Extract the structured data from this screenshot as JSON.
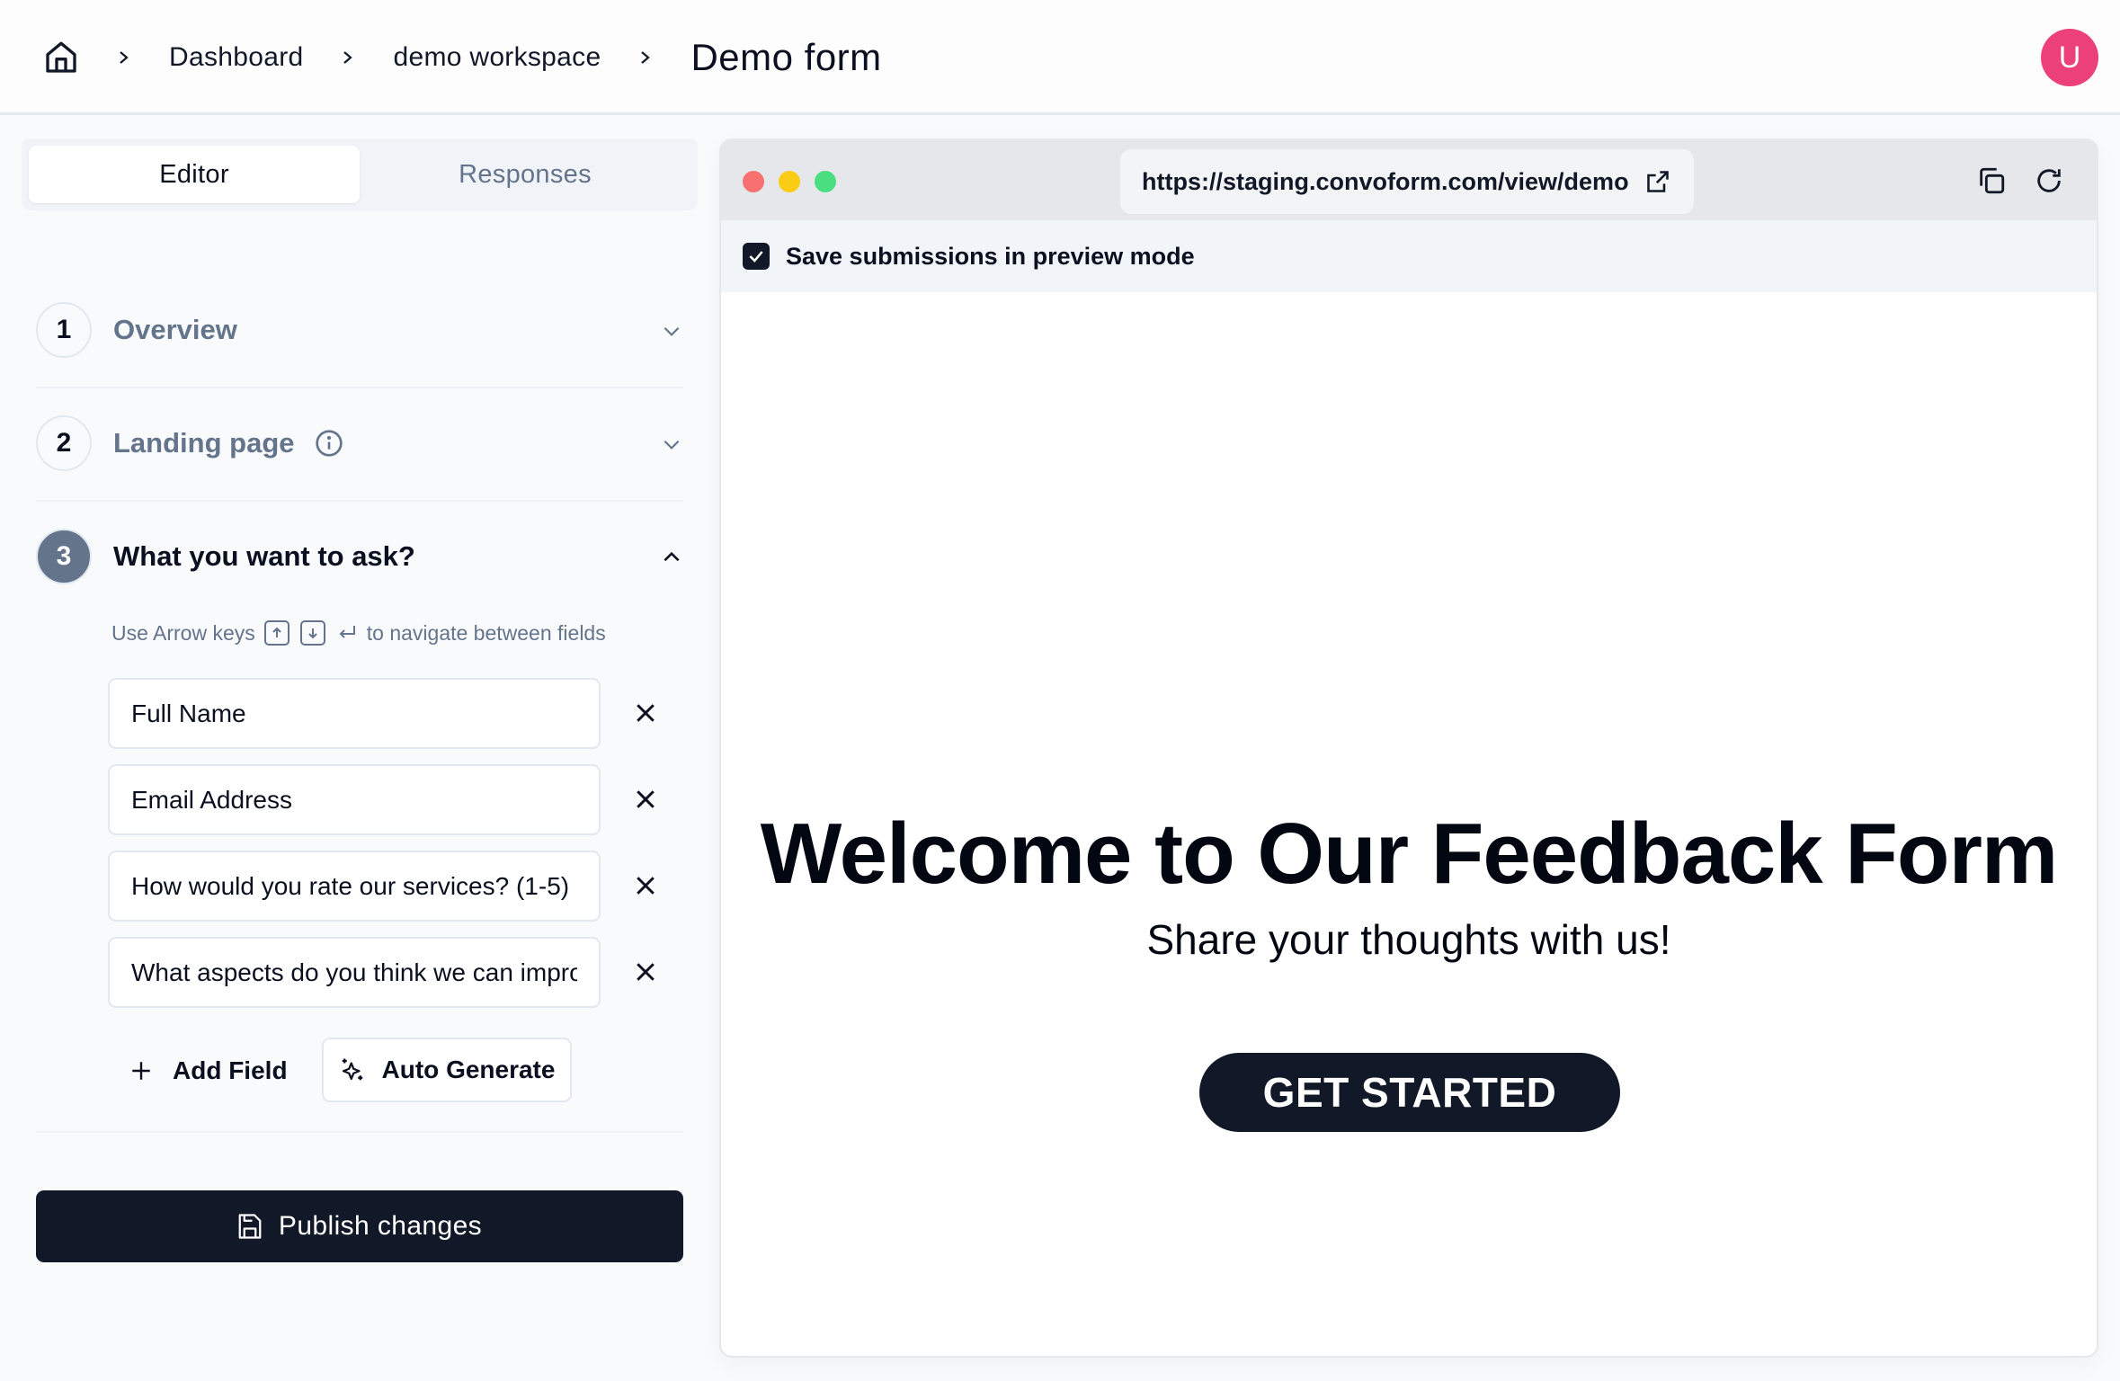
{
  "header": {
    "breadcrumbs": [
      "Dashboard",
      "demo workspace"
    ],
    "current": "Demo form",
    "avatar_initial": "U",
    "avatar_color": "#ec407a"
  },
  "tabs": [
    {
      "label": "Editor",
      "active": true
    },
    {
      "label": "Responses",
      "active": false
    }
  ],
  "steps": [
    {
      "number": "1",
      "title": "Overview",
      "expanded": false
    },
    {
      "number": "2",
      "title": "Landing page",
      "expanded": false,
      "has_info": true
    },
    {
      "number": "3",
      "title": "What you want to ask?",
      "expanded": true
    }
  ],
  "hint": {
    "prefix": "Use Arrow keys",
    "suffix": "to navigate between fields"
  },
  "fields": [
    {
      "value": "Full Name"
    },
    {
      "value": "Email Address"
    },
    {
      "value": "How would you rate our services? (1-5)"
    },
    {
      "value": "What aspects do you think we can improve?"
    }
  ],
  "actions": {
    "add_field": "Add Field",
    "auto_generate": "Auto Generate",
    "publish": "Publish changes"
  },
  "preview": {
    "url": "https://staging.convoform.com/view/demo",
    "save_submissions_label": "Save submissions in preview mode",
    "save_submissions_checked": true,
    "heading": "Welcome to Our Feedback Form",
    "tagline": "Share your thoughts with us!",
    "cta": "GET STARTED",
    "dot_colors": [
      "#f87171",
      "#facc15",
      "#4ade80"
    ]
  },
  "colors": {
    "primary_dark": "#111827",
    "muted": "#64748b"
  }
}
